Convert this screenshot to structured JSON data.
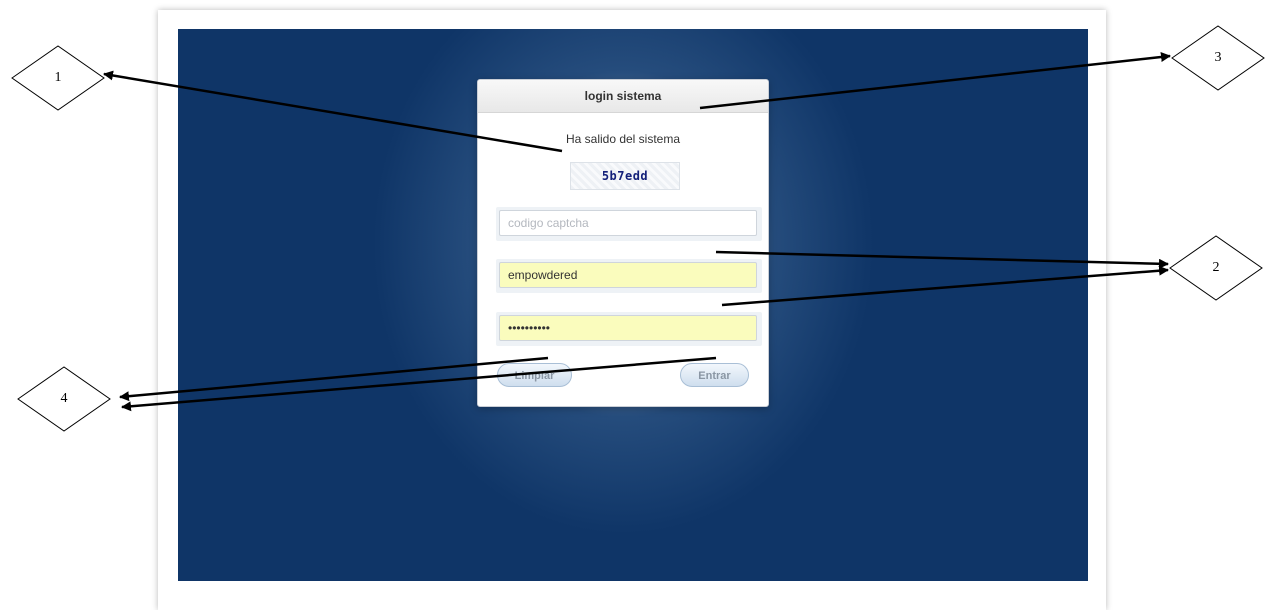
{
  "login": {
    "title": "login sistema",
    "status_message": "Ha salido del sistema",
    "captcha_text": "5b7edd",
    "captcha_placeholder": "codigo captcha",
    "username_value": "empowdered",
    "password_value": "••••••••••",
    "clear_label": "Limpiar",
    "submit_label": "Entrar"
  },
  "callouts": {
    "one": "1",
    "two": "2",
    "three": "3",
    "four": "4"
  },
  "colors": {
    "screen_background": "#0f3567",
    "filled_input": "#fafcbd",
    "button_border": "#a9bfd6"
  }
}
